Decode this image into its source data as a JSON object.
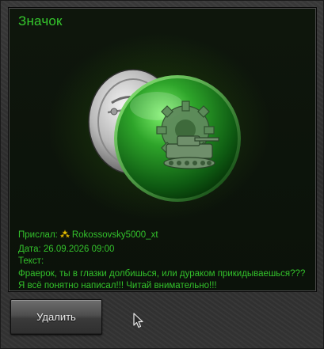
{
  "dialog": {
    "title": "Значок",
    "badge_icon": "green-gear-tank-badge-icon",
    "sender_label": "Прислал:",
    "sender_icon": "rank-stars-icon",
    "sender_name": "Rokossovsky5000_xt",
    "date_label": "Дата:",
    "date_value": "26.09.2026 09:00",
    "text_label": "Текст:",
    "message": "Фраерок, ты в глазки долбишься, или дураком прикидываешься??? Я всё понятно написал!!! Читай внимательно!!!",
    "delete_button": "Удалить"
  },
  "colors": {
    "accent_text": "#35c82d",
    "panel_bg": "#0b120a",
    "frame_bg": "#333333",
    "button_text": "#f0f0f0"
  }
}
